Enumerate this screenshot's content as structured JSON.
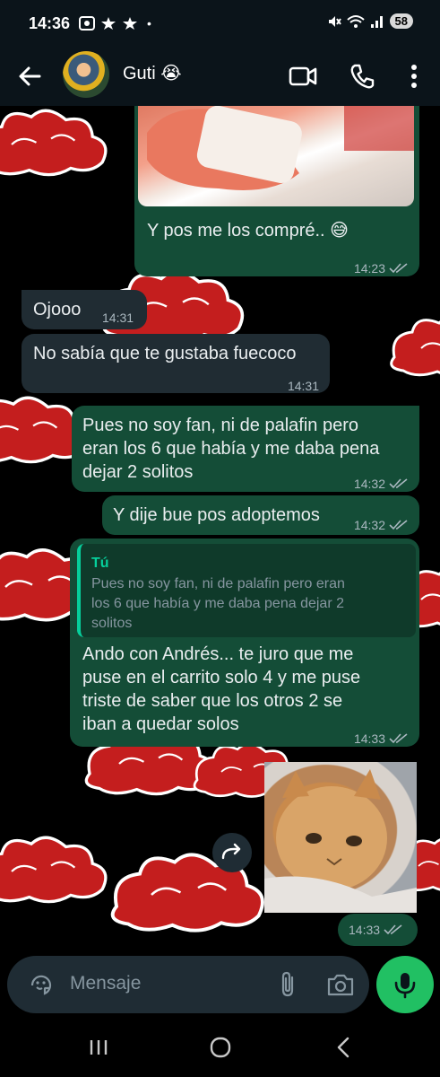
{
  "status_bar": {
    "time": "14:36",
    "dot": "•",
    "battery": "58",
    "icons_left": [
      "screenshot-icon",
      "notification-icon",
      "notification-icon"
    ],
    "icons_right": [
      "mute-icon",
      "wifi-icon",
      "signal-icon"
    ]
  },
  "header": {
    "contact_name": "Guti 😭"
  },
  "messages": [
    {
      "dir": "out",
      "text": "Y pos me los compré.. 😅",
      "time": "14:23"
    },
    {
      "dir": "in",
      "text": "Ojooo",
      "time": "14:31"
    },
    {
      "dir": "in",
      "text": "No sabía que te gustaba fuecoco",
      "time": "14:31"
    },
    {
      "dir": "out",
      "lines": [
        "Pues no soy fan, ni de palafin pero",
        "eran los 6 que había y me daba pena",
        "dejar 2 solitos"
      ],
      "time": "14:32"
    },
    {
      "dir": "out",
      "text": "Y dije bue pos adoptemos",
      "time": "14:32"
    },
    {
      "dir": "out",
      "quote_author": "Tú",
      "quote_lines": [
        "Pues no soy fan, ni de palafin pero eran",
        "los 6 que había y me daba pena dejar 2",
        "solitos"
      ],
      "lines": [
        "Ando con Andrés... te juro que me",
        "puse en el carrito solo 4 y me puse",
        "triste de saber que los otros 2 se",
        "iban a quedar solos"
      ],
      "time": "14:33"
    },
    {
      "dir": "out",
      "type": "image",
      "time": "14:33"
    }
  ],
  "composer": {
    "placeholder": "Mensaje"
  },
  "colors": {
    "outgoing": "#144d37",
    "incoming": "#202c33",
    "accent": "#21c063",
    "quote_bar": "#06cf9c",
    "wallpaper_cloud": "#c41e1e"
  }
}
